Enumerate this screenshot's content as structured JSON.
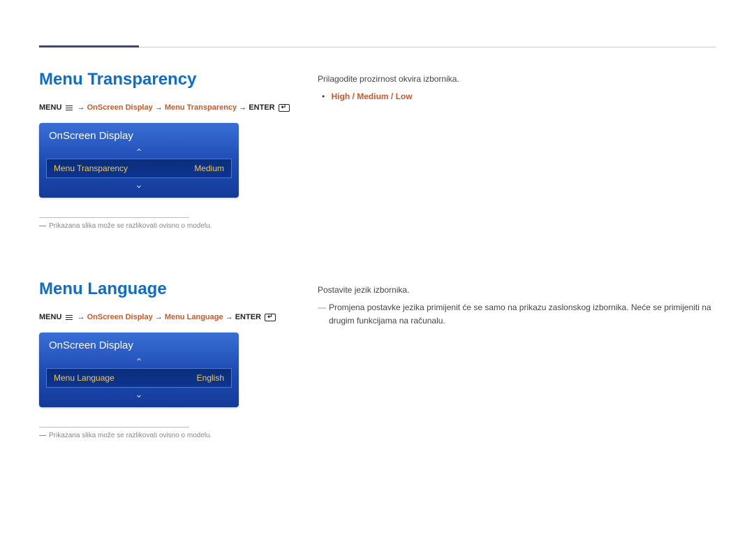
{
  "section1": {
    "title": "Menu Transparency",
    "breadcrumb": {
      "menu": "MENU",
      "arrow": "→",
      "p1": "OnScreen Display",
      "p2": "Menu Transparency",
      "enter": "ENTER"
    },
    "osd": {
      "header": "OnScreen Display",
      "label": "Menu Transparency",
      "value": "Medium"
    },
    "footnote_dash": "―",
    "footnote": "Prikazana slika može se razlikovati ovisno o modelu.",
    "right": {
      "desc": "Prilagodite prozirnost okvira izbornika.",
      "dot": "•",
      "opt1": "High",
      "sep": " / ",
      "opt2": "Medium",
      "opt3": "Low"
    }
  },
  "section2": {
    "title": "Menu Language",
    "breadcrumb": {
      "menu": "MENU",
      "arrow": "→",
      "p1": "OnScreen Display",
      "p2": "Menu Language",
      "enter": "ENTER"
    },
    "osd": {
      "header": "OnScreen Display",
      "label": "Menu Language",
      "value": "English"
    },
    "footnote_dash": "―",
    "footnote": "Prikazana slika može se razlikovati ovisno o modelu.",
    "right": {
      "desc": "Postavite jezik izbornika.",
      "note_dash": "―",
      "note": "Promjena postavke jezika primijenit će se samo na prikazu zaslonskog izbornika. Neće se primijeniti na drugim funkcijama na računalu."
    }
  }
}
